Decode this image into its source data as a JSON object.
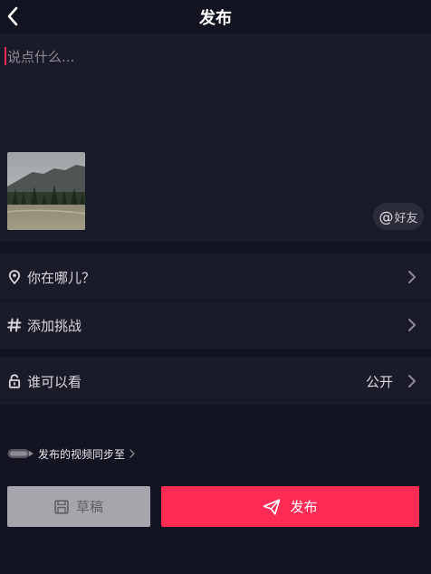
{
  "header": {
    "title": "发布"
  },
  "compose": {
    "placeholder": "说点什么...",
    "mention_label": "好友",
    "mention_symbol": "@"
  },
  "options": {
    "location": {
      "label": "你在哪儿？"
    },
    "challenge": {
      "label": "添加挑战"
    },
    "privacy": {
      "label": "谁可以看",
      "value": "公开"
    }
  },
  "sync": {
    "text": "发布的视频同步至"
  },
  "actions": {
    "draft_label": "草稿",
    "publish_label": "发布"
  },
  "colors": {
    "background": "#121421",
    "panel": "#191b29",
    "accent": "#fe2c55",
    "draft_button": "#a5a6ab"
  }
}
